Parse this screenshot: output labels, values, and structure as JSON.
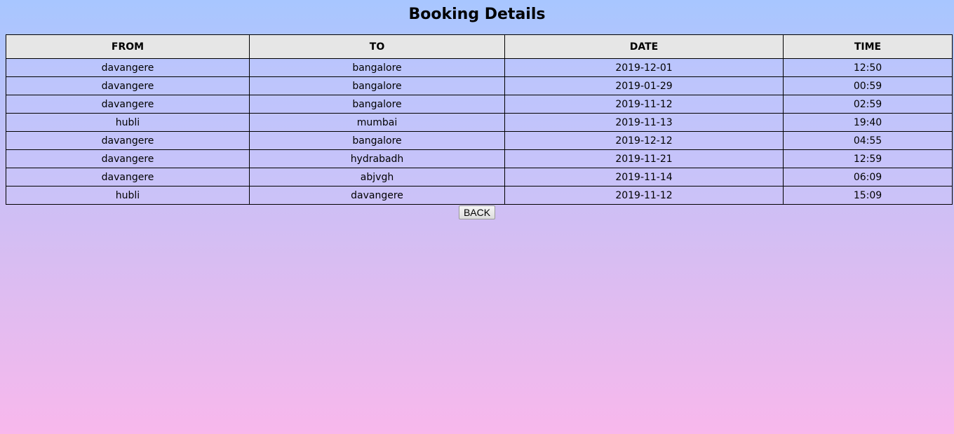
{
  "title": "Booking Details",
  "table": {
    "headers": [
      "FROM",
      "TO",
      "DATE",
      "TIME"
    ],
    "rows": [
      [
        "davangere",
        "bangalore",
        "2019-12-01",
        "12:50"
      ],
      [
        "davangere",
        "bangalore",
        "2019-01-29",
        "00:59"
      ],
      [
        "davangere",
        "bangalore",
        "2019-11-12",
        "02:59"
      ],
      [
        "hubli",
        "mumbai",
        "2019-11-13",
        "19:40"
      ],
      [
        "davangere",
        "bangalore",
        "2019-12-12",
        "04:55"
      ],
      [
        "davangere",
        "hydrabadh",
        "2019-11-21",
        "12:59"
      ],
      [
        "davangere",
        "abjvgh",
        "2019-11-14",
        "06:09"
      ],
      [
        "hubli",
        "davangere",
        "2019-11-12",
        "15:09"
      ]
    ]
  },
  "back_label": "BACK"
}
